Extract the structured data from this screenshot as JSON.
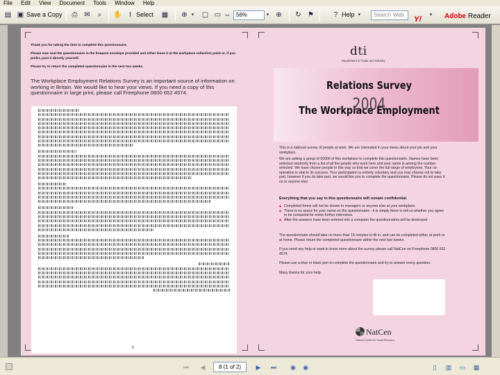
{
  "menu": [
    "File",
    "Edit",
    "View",
    "Document",
    "Tools",
    "Window",
    "Help"
  ],
  "toolbar": {
    "save_copy_label": "Save a Copy",
    "select_label": "Select",
    "zoom_value": "56%",
    "help_label": "Help",
    "search_placeholder": "Search Web",
    "adobe_brand": "Adobe",
    "adobe_product": "Reader"
  },
  "left_page": {
    "intro_lines": [
      "Thank you for taking the time to complete this questionnaire.",
      "Please now seal the questionnaire in the freepost envelope provided and either leave it at the workplace collection point or, if you prefer, post it directly yourself.",
      "Please try to return the completed questionnaire in the next two weeks."
    ],
    "main_intro": "The Workplace Employment Relations Survey is an important source of information on working in Britain. We would like to hear your views. If you need a copy of this questionnaire in large print, please call Freephone 0800 652 4574.",
    "page_number": "8"
  },
  "right_page": {
    "logo": "dti",
    "logo_sub": "Department of Trade and Industry",
    "title_line1": "The Workplace Employment",
    "title_line2": "Relations Survey",
    "title_year": "2004",
    "para1": "This is a national survey of people at work. We are interested in your views about your job and your workplace.",
    "para2": "We are asking a group of 50000 of this workplace to complete this questionnaire. Names have been selected randomly from a list of all the people who work here and your name is among the number selected. We have chosen people in this way so that we cover the full range of employees. Your co-operation is vital to its success. Your participation is entirely voluntary and you may choose not to take part, however if you do take part, we would like you to complete the questionnaire. Please do not pass it on to anyone else.",
    "confidential_head": "Everything that you say in this questionnaire will remain confidential.",
    "bullets": [
      "Completed forms will not be shown to managers or anyone else at your workplace.",
      "There is no space for your name on the questionnaire - it is simply there to tell us whether you agree to be contacted for some further interviews.",
      "After the answers have been entered into a computer the questionnaires will be destroyed."
    ],
    "para3": "The questionnaire should take no more than 15 minutes to fill in, and can be completed either at work or at home. Please return the completed questionnaire within the next two weeks.",
    "para4": "If you need any help or want to know more about the survey please call NatCen on Freephone 0800 652 4574.",
    "para5": "Please use a blue or black pen to complete the questionnaire and try to answer every question.",
    "para6": "Many thanks for your help.",
    "natcen": "NatCen",
    "natcen_sub": "National Centre for Social Research"
  },
  "status": {
    "page_field": "8 (1 of 2)"
  }
}
